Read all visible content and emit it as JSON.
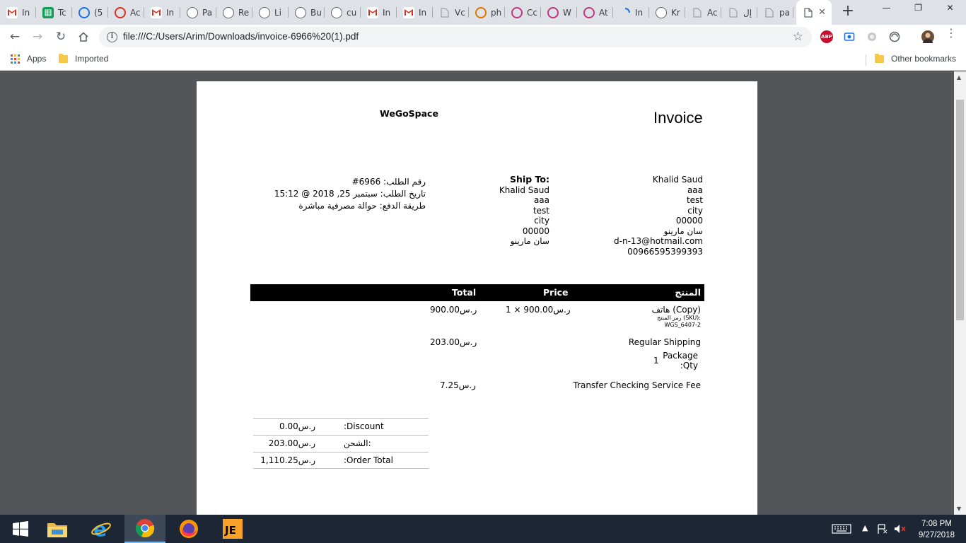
{
  "browser": {
    "tabs": [
      {
        "title": "In",
        "icon": "gmail-icon",
        "color": "#d93025"
      },
      {
        "title": "Tc",
        "icon": "sheets-icon",
        "color": "#0f9d58"
      },
      {
        "title": "(5",
        "icon": "mail-icon",
        "color": "#1a73e8"
      },
      {
        "title": "Ac",
        "icon": "target-icon",
        "color": "#d93025"
      },
      {
        "title": "In",
        "icon": "gmail-icon",
        "color": "#d93025"
      },
      {
        "title": "Pa",
        "icon": "site-icon",
        "color": "#5f6368"
      },
      {
        "title": "Re",
        "icon": "site-icon",
        "color": "#5f6368"
      },
      {
        "title": "Li",
        "icon": "site-icon",
        "color": "#5f6368"
      },
      {
        "title": "Bu",
        "icon": "site-icon",
        "color": "#5f6368"
      },
      {
        "title": "cu",
        "icon": "site-icon",
        "color": "#5f6368"
      },
      {
        "title": "In",
        "icon": "gmail-icon",
        "color": "#d93025"
      },
      {
        "title": "In",
        "icon": "gmail-icon",
        "color": "#d93025"
      },
      {
        "title": "Vc",
        "icon": "document-icon",
        "color": "#9aa0a6"
      },
      {
        "title": "ph",
        "icon": "image-icon",
        "color": "#e37400"
      },
      {
        "title": "Cc",
        "icon": "instagram-icon",
        "color": "#c13584"
      },
      {
        "title": "W",
        "icon": "instagram-icon",
        "color": "#c13584"
      },
      {
        "title": "At",
        "icon": "instagram-icon",
        "color": "#c13584"
      },
      {
        "title": "In",
        "icon": "loading-icon",
        "color": "#1a73e8"
      },
      {
        "title": "Kr",
        "icon": "site-icon",
        "color": "#5f6368"
      },
      {
        "title": "Ac",
        "icon": "document-icon",
        "color": "#9aa0a6"
      },
      {
        "title": "إل",
        "icon": "document-icon",
        "color": "#9aa0a6"
      },
      {
        "title": "pa",
        "icon": "document-icon",
        "color": "#9aa0a6"
      }
    ],
    "active_tab_icon": "document-icon",
    "url": "file:///C:/Users/Arim/Downloads/invoice-6966%20(1).pdf",
    "extension_abp": "ABP",
    "bookmarks": {
      "apps": "Apps",
      "imported": "Imported",
      "other": "Other bookmarks"
    }
  },
  "invoice": {
    "shop_name": "WeGoSpace",
    "title": "Invoice",
    "order_lines": [
      "رقم الطلب:  6966#",
      "تاريخ الطلب: سبتمبر 25, 2018 @ 15:12",
      "طريقة الدفع: حوالة مصرفية مباشرة"
    ],
    "ship_to_label": "Ship To:",
    "ship_to": [
      "Khalid Saud",
      "aaa",
      "test",
      "city",
      "00000",
      "سان مارينو"
    ],
    "bill_to": [
      "Khalid Saud",
      "aaa",
      "test",
      "city",
      "00000",
      "سان مارينو",
      "d-n-13@hotmail.com",
      "00966595399393"
    ],
    "columns": {
      "product": "المنتج",
      "price": "Price",
      "total": "Total"
    },
    "items": [
      {
        "name": "هاتف (Copy)",
        "sku_label": "رمز المنتج (SKU):",
        "sku": "WGS_6407-2",
        "price": "ر.س900.00 × 1",
        "total": "ر.س900.00"
      },
      {
        "name": "Regular Shipping",
        "meta_label": "Package",
        "meta_label2": ":Qty",
        "meta_value": "1",
        "price": "",
        "total": "ر.س203.00"
      },
      {
        "name": "Transfer Checking Service Fee",
        "price": "",
        "total": "ر.س7.25"
      }
    ],
    "totals": [
      {
        "label": ":Discount",
        "value": "ر.س0.00"
      },
      {
        "label": "الشحن:",
        "value": "ر.س203.00"
      },
      {
        "label": ":Order Total",
        "value": "ر.س1,110.25"
      }
    ]
  },
  "taskbar": {
    "apps": [
      "file-explorer-icon",
      "internet-explorer-icon",
      "chrome-icon",
      "firefox-icon",
      "jetbrains-icon"
    ],
    "time": "7:08 PM",
    "date": "9/27/2018"
  },
  "colors": {
    "accent": "#1a73e8",
    "viewer_bg": "#525659",
    "taskbar": "#1c2635"
  }
}
